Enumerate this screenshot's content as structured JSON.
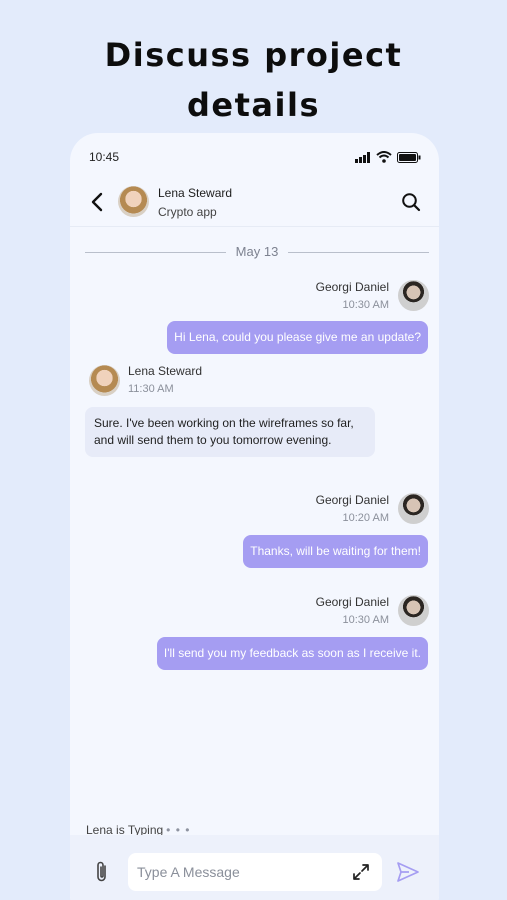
{
  "promo": {
    "headline_line1": "Discuss project",
    "headline_line2": "details"
  },
  "status_bar": {
    "time": "10:45"
  },
  "header": {
    "contact_name": "Lena Steward",
    "contact_subtitle": "Crypto app"
  },
  "chat": {
    "date_divider": "May 13",
    "messages": [
      {
        "sender": "Georgi Daniel",
        "time": "10:30 AM",
        "text": "Hi Lena, could you please give me an update?",
        "direction": "out"
      },
      {
        "sender": "Lena Steward",
        "time": "11:30 AM",
        "line1": "Sure. I've been working on the wireframes so far,",
        "line2": "and will send them to you tomorrow evening.",
        "direction": "in"
      },
      {
        "sender": "Georgi Daniel",
        "time": "10:20 AM",
        "text": "Thanks, will be waiting for them!",
        "direction": "out"
      },
      {
        "sender": "Georgi Daniel",
        "time": "10:30 AM",
        "text": "I'll send you my feedback as soon as I receive it.",
        "direction": "out"
      }
    ],
    "typing_indicator": "Lena is Typing",
    "typing_dots": "• • •"
  },
  "composer": {
    "placeholder": "Type A Message"
  },
  "colors": {
    "outgoing_bubble": "#a59df2",
    "incoming_bubble": "#e7ebf8",
    "page_background": "#e3ebfb"
  },
  "icons": [
    "back-icon",
    "search-icon",
    "signal-icon",
    "wifi-icon",
    "battery-icon",
    "paperclip-icon",
    "expand-icon",
    "send-icon"
  ]
}
